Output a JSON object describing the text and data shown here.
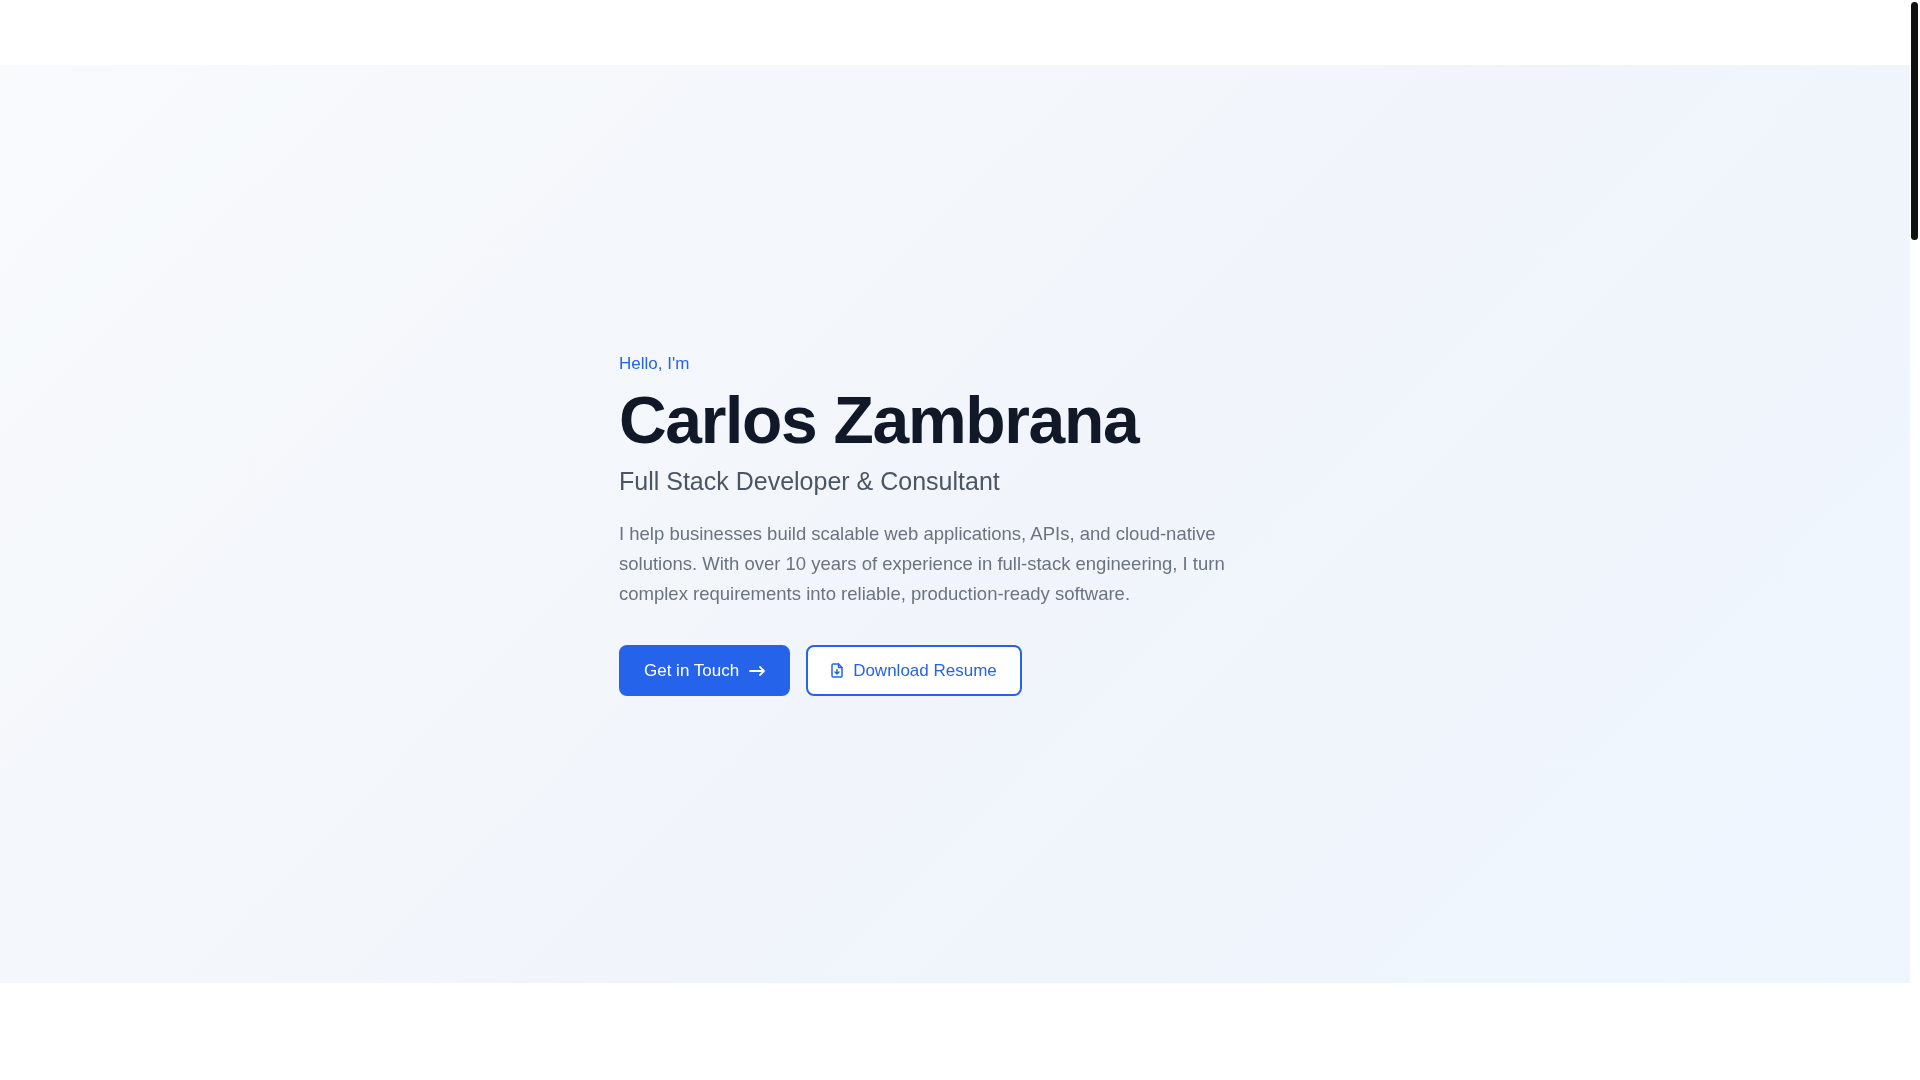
{
  "hero": {
    "greeting": "Hello, I'm",
    "name": "Carlos Zambrana",
    "title": "Full Stack Developer & Consultant",
    "description": "I help businesses build scalable web applications, APIs, and cloud-native solutions. With over 10 years of experience in full-stack engineering, I turn complex requirements into reliable, production-ready software.",
    "buttons": [
      {
        "label": "Get in Touch",
        "kind": "primary"
      },
      {
        "label": "Download Resume",
        "kind": "outline"
      }
    ]
  }
}
